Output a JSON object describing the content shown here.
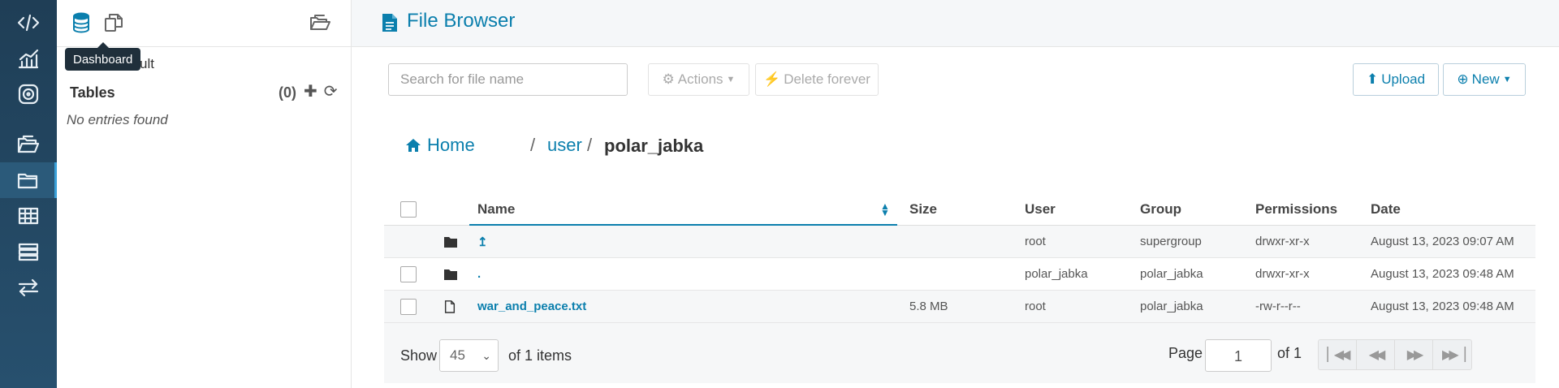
{
  "colors": {
    "nav_bg": "#1f3e56",
    "accent": "#0b7fad",
    "text": "#333333"
  },
  "leftnav": {
    "items": [
      {
        "icon": "code-icon"
      },
      {
        "icon": "chart-icon"
      },
      {
        "icon": "target-icon"
      },
      {
        "icon": "open-folder-icon"
      },
      {
        "icon": "folder-icon",
        "active": true
      },
      {
        "icon": "table-icon"
      },
      {
        "icon": "list-icon"
      },
      {
        "icon": "transfer-icon"
      }
    ]
  },
  "assist": {
    "tooltip": "Dashboard",
    "db_name": "ult",
    "tables_label": "Tables",
    "tables_count": "(0)",
    "add_symbol": "✚",
    "refresh_symbol": "⟳",
    "empty_message": "No entries found"
  },
  "header": {
    "title": "File Browser"
  },
  "toolbar": {
    "search_placeholder": "Search for file name",
    "actions_label": "Actions",
    "delete_label": "Delete forever",
    "upload_label": "Upload",
    "new_label": "New"
  },
  "breadcrumb": {
    "home": "Home",
    "sep1": "/",
    "user": "user",
    "sep2": "/",
    "current": "polar_jabka"
  },
  "table": {
    "columns": {
      "name": "Name",
      "size": "Size",
      "user": "User",
      "group": "Group",
      "permissions": "Permissions",
      "date": "Date"
    },
    "rows": [
      {
        "type": "folder",
        "name": "↥",
        "size": "",
        "user": "root",
        "group": "supergroup",
        "permissions": "drwxr-xr-x",
        "date": "August 13, 2023 09:07 AM"
      },
      {
        "type": "folder",
        "name": ".",
        "size": "",
        "user": "polar_jabka",
        "group": "polar_jabka",
        "permissions": "drwxr-xr-x",
        "date": "August 13, 2023 09:48 AM"
      },
      {
        "type": "file",
        "name": "war_and_peace.txt",
        "size": "5.8 MB",
        "user": "root",
        "group": "polar_jabka",
        "permissions": "-rw-r--r--",
        "date": "August 13, 2023 09:48 AM"
      }
    ]
  },
  "footer": {
    "show_label": "Show",
    "page_size": "45",
    "of_items": "of 1 items",
    "page_label": "Page",
    "page_value": "1",
    "of_pages": "of 1"
  }
}
